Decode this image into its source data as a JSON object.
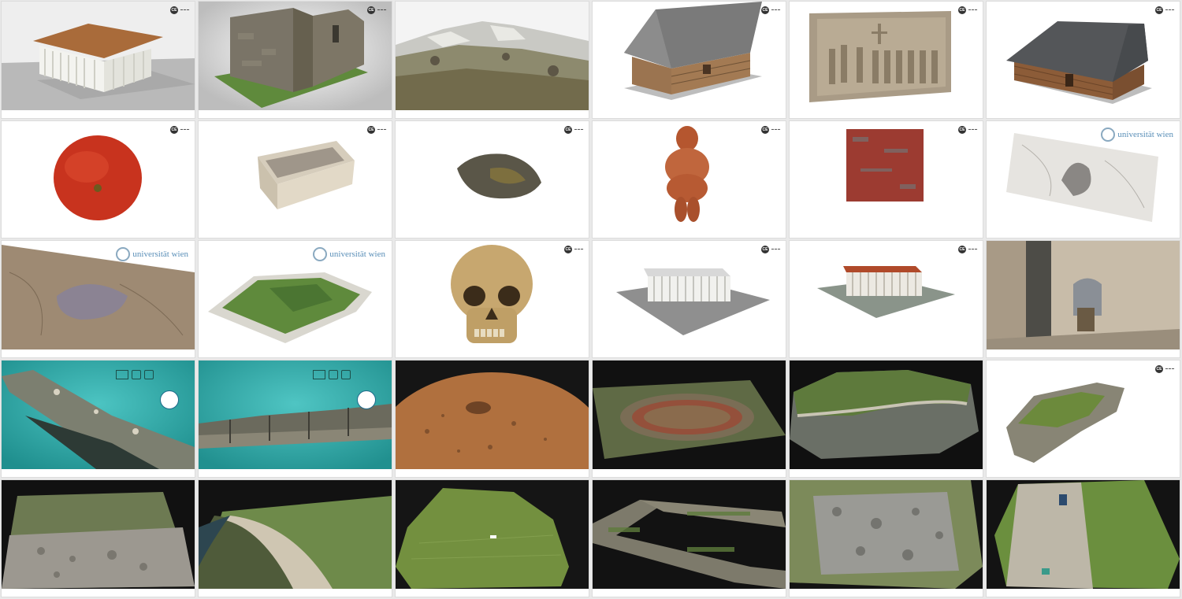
{
  "gallery": {
    "tiles": [
      {
        "id": "doric-temple",
        "icon": "doric-temple-model-thumbnail",
        "bg": "#eeeeee"
      },
      {
        "id": "stone-ruin",
        "icon": "stone-church-ruin-thumbnail",
        "bg": "#e4e4e4"
      },
      {
        "id": "rocky-terrain",
        "icon": "rocky-mountain-terrain-thumbnail",
        "bg": "#f4f4f4"
      },
      {
        "id": "log-cabin-a",
        "icon": "log-cabin-model-thumbnail",
        "bg": "#ffffff"
      },
      {
        "id": "stone-relief",
        "icon": "carved-stone-relief-thumbnail",
        "bg": "#ffffff"
      },
      {
        "id": "log-cabin-b",
        "icon": "log-house-model-thumbnail",
        "bg": "#ffffff"
      },
      {
        "id": "tomato",
        "icon": "tomato-scan-thumbnail",
        "bg": "#ffffff"
      },
      {
        "id": "stone-trough",
        "icon": "stone-trough-thumbnail",
        "bg": "#ffffff"
      },
      {
        "id": "stone-tool",
        "icon": "stone-artifact-thumbnail",
        "bg": "#ffffff"
      },
      {
        "id": "venus-figurine",
        "icon": "venus-figurine-thumbnail",
        "bg": "#ffffff"
      },
      {
        "id": "painted-tile",
        "icon": "painted-plaster-fragment-thumbnail",
        "bg": "#ffffff"
      },
      {
        "id": "sketch-surface",
        "icon": "engraved-surface-thumbnail",
        "bg": "#ffffff"
      },
      {
        "id": "terrain-relief",
        "icon": "terrain-relief-thumbnail",
        "bg": "#ffffff"
      },
      {
        "id": "green-mound",
        "icon": "excavation-mound-thumbnail",
        "bg": "#ffffff"
      },
      {
        "id": "skull",
        "icon": "human-skull-thumbnail",
        "bg": "#ffffff"
      },
      {
        "id": "parthenon-a",
        "icon": "classical-temple-thumbnail",
        "bg": "#ffffff"
      },
      {
        "id": "parthenon-b",
        "icon": "classical-temple-thumbnail",
        "bg": "#ffffff"
      },
      {
        "id": "stone-interior",
        "icon": "vaulted-room-interior-thumbnail",
        "bg": "#cbbfae"
      },
      {
        "id": "underwater-a",
        "icon": "underwater-site-thumbnail",
        "bg": "#2fa8a6"
      },
      {
        "id": "underwater-b",
        "icon": "underwater-cliff-thumbnail",
        "bg": "#33aaa8"
      },
      {
        "id": "crater",
        "icon": "crater-terrain-thumbnail",
        "bg": "#151515"
      },
      {
        "id": "arena",
        "icon": "roman-arena-site-thumbnail",
        "bg": "#111111"
      },
      {
        "id": "coastline",
        "icon": "coastline-terrain-thumbnail",
        "bg": "#101010"
      },
      {
        "id": "mossy-rock",
        "icon": "mossy-rock-thumbnail",
        "bg": "#ffffff"
      },
      {
        "id": "rubble-field",
        "icon": "rubble-field-thumbnail",
        "bg": "#111111"
      },
      {
        "id": "shoreline",
        "icon": "shoreline-terrain-thumbnail",
        "bg": "#121212"
      },
      {
        "id": "grass-field",
        "icon": "grass-field-terrain-thumbnail",
        "bg": "#151515"
      },
      {
        "id": "wall-ruin",
        "icon": "wall-ruin-thumbnail",
        "bg": "#121212"
      },
      {
        "id": "stone-pile",
        "icon": "stone-pile-thumbnail",
        "bg": "#141414"
      },
      {
        "id": "grass-path",
        "icon": "overgrown-path-thumbnail",
        "bg": "#131313"
      }
    ]
  },
  "branding": {
    "university": "universität wien"
  }
}
